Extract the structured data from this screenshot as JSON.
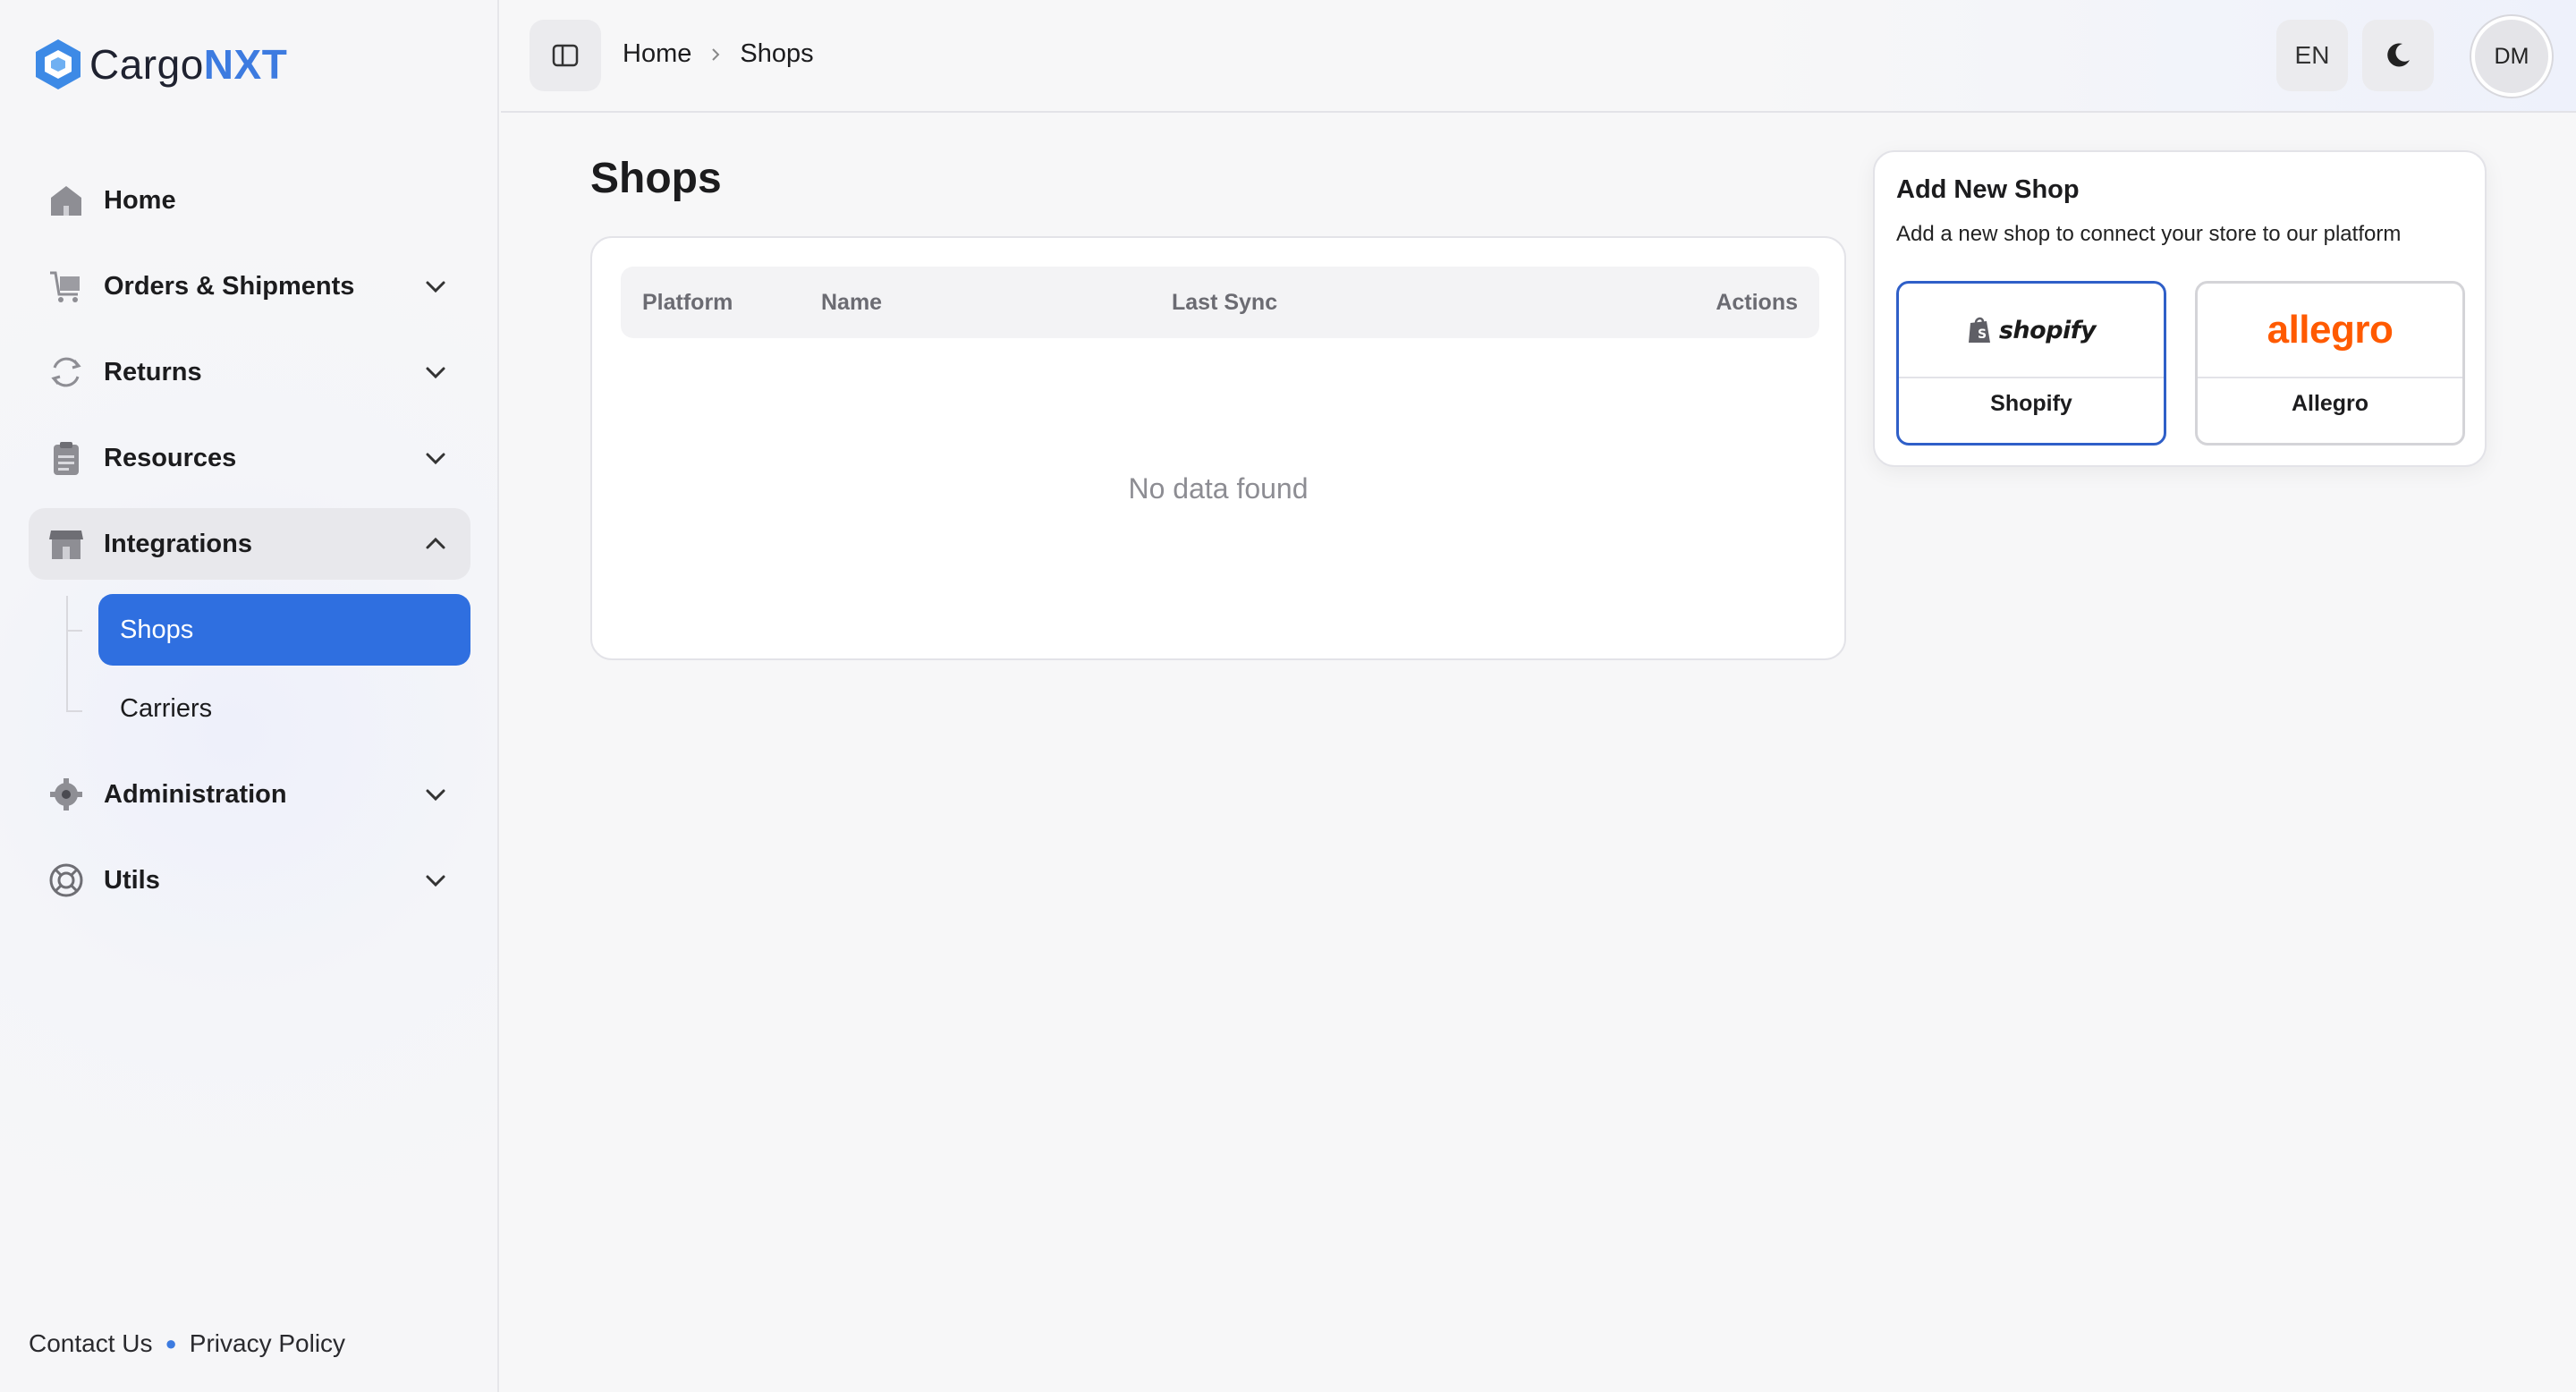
{
  "app": {
    "brand_prefix": "Cargo",
    "brand_suffix": "NXT"
  },
  "sidebar": {
    "items": [
      {
        "label": "Home",
        "icon": "home-icon"
      },
      {
        "label": "Orders & Shipments",
        "icon": "cart-icon"
      },
      {
        "label": "Returns",
        "icon": "returns-icon"
      },
      {
        "label": "Resources",
        "icon": "clipboard-icon"
      },
      {
        "label": "Integrations",
        "icon": "store-icon"
      },
      {
        "label": "Administration",
        "icon": "gear-icon"
      },
      {
        "label": "Utils",
        "icon": "lifebuoy-icon"
      }
    ],
    "integrations_children": [
      {
        "label": "Shops",
        "active": true
      },
      {
        "label": "Carriers",
        "active": false
      }
    ],
    "footer": {
      "contact": "Contact Us",
      "privacy": "Privacy Policy"
    }
  },
  "topbar": {
    "breadcrumb": [
      "Home",
      "Shops"
    ],
    "language": "EN",
    "avatar_initials": "DM"
  },
  "main": {
    "title": "Shops",
    "table": {
      "columns": [
        "Platform",
        "Name",
        "Last Sync",
        "Actions"
      ],
      "rows": [],
      "empty_text": "No data found"
    }
  },
  "popover": {
    "title": "Add New Shop",
    "subtitle": "Add a new shop to connect your store to our platform",
    "platforms": [
      {
        "name": "Shopify",
        "logo_text": "shopify",
        "selected": true
      },
      {
        "name": "Allegro",
        "logo_text": "allegro",
        "selected": false
      }
    ]
  },
  "colors": {
    "accent": "#2f6fe0",
    "brand": "#3d7be0",
    "allegro": "#ff5a00"
  }
}
